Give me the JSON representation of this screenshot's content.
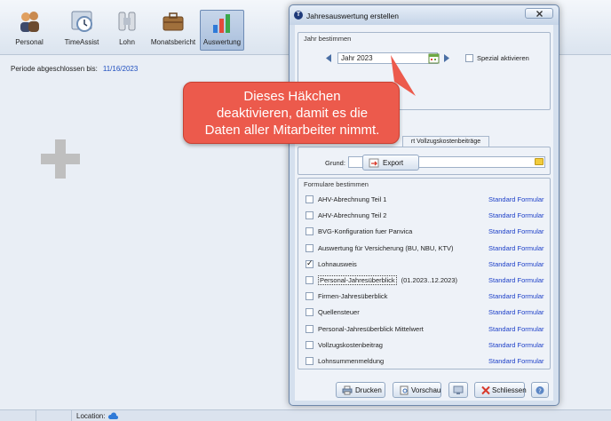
{
  "toolbar": {
    "items": [
      {
        "label": "Personal",
        "icon": "people-icon"
      },
      {
        "label": "TimeAssist",
        "icon": "clock-icon"
      },
      {
        "label": "Lohn",
        "icon": "payroll-icon"
      },
      {
        "label": "Monatsbericht",
        "icon": "briefcase-icon"
      },
      {
        "label": "Auswertung",
        "icon": "chart-icon",
        "active": true
      }
    ]
  },
  "main": {
    "periode_label": "Periode abgeschlossen bis:",
    "periode_date": "11/16/2023"
  },
  "statusbar": {
    "location_label": "Location:"
  },
  "dialog": {
    "title": "Jahresauswertung erstellen",
    "jahr_group": {
      "title": "Jahr bestimmen",
      "year_value": "Jahr 2023",
      "spezial_label": "Spezial aktivieren",
      "spezial_checked": false
    },
    "tab_label": "rt Vollzugskostenbeiträge",
    "grund_label": "Grund:",
    "export_label": "Export",
    "formulare": {
      "title": "Formulare bestimmen",
      "items": [
        {
          "label": "AHV-Abrechnung Teil 1",
          "checked": false,
          "std": "Standard Formular"
        },
        {
          "label": "AHV-Abrechnung Teil 2",
          "checked": false,
          "std": "Standard Formular"
        },
        {
          "label": "BVG-Konfiguration fuer Panvica",
          "checked": false,
          "std": "Standard Formular"
        },
        {
          "label": "Auswertung für Versicherung (BU, NBU, KTV)",
          "checked": false,
          "std": "Standard Formular"
        },
        {
          "label": "Lohnausweis",
          "checked": true,
          "std": "Standard Formular"
        },
        {
          "label": "Personal-Jahresüberblick",
          "checked": false,
          "std": "Standard Formular",
          "extra": "(01.2023..12.2023)",
          "focused": true
        },
        {
          "label": "Firmen-Jahresüberblick",
          "checked": false,
          "std": "Standard Formular"
        },
        {
          "label": "Quellensteuer",
          "checked": false,
          "std": "Standard Formular"
        },
        {
          "label": "Personal-Jahresüberblick Mittelwert",
          "checked": false,
          "std": "Standard Formular"
        },
        {
          "label": "Vollzugskostenbeitrag",
          "checked": false,
          "std": "Standard Formular"
        },
        {
          "label": "Lohnsummenmeldung",
          "checked": false,
          "std": "Standard Formular"
        }
      ]
    },
    "buttons": {
      "drucken": "Drucken",
      "vorschau": "Vorschau",
      "schliessen": "Schliessen"
    }
  },
  "callout": {
    "line1": "Dieses Häkchen",
    "line2": "deaktivieren, damit es die",
    "line3": "Daten aller Mitarbeiter nimmt."
  },
  "colors": {
    "accent_link": "#1c3fc8",
    "callout": "#ec5a4c",
    "date": "#1f4fbf"
  }
}
